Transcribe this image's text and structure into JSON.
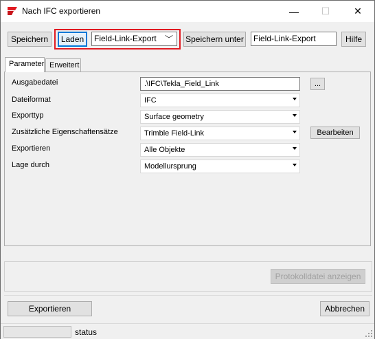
{
  "window": {
    "title": "Nach IFC exportieren",
    "icon": "tekla-red-icon",
    "controls": {
      "minimize": "—",
      "maximize": "☐",
      "close": "✕"
    }
  },
  "toolbar": {
    "save_label": "Speichern",
    "load_label": "Laden",
    "preset_selected": "Field-Link-Export",
    "save_as_label": "Speichern unter",
    "save_as_name": "Field-Link-Export",
    "help_label": "Hilfe"
  },
  "tabs": [
    {
      "label": "Parameter",
      "active": true
    },
    {
      "label": "Erweitert",
      "active": false
    }
  ],
  "parameters": {
    "output_file": {
      "label": "Ausgabedatei",
      "value": ".\\IFC\\Tekla_Field_Link",
      "browse_label": "..."
    },
    "file_format": {
      "label": "Dateiformat",
      "value": "IFC"
    },
    "export_type": {
      "label": "Exporttyp",
      "value": "Surface geometry"
    },
    "property_sets": {
      "label": "Zusätzliche Eigenschaftensätze",
      "value": "Trimble Field-Link",
      "edit_label": "Bearbeiten"
    },
    "export_scope": {
      "label": "Exportieren",
      "value": "Alle Objekte"
    },
    "location_by": {
      "label": "Lage durch",
      "value": "Modellursprung"
    }
  },
  "log_button_label": "Protokolldatei anzeigen",
  "footer": {
    "export_label": "Exportieren",
    "cancel_label": "Abbrechen"
  },
  "statusbar": {
    "text": "status",
    "progress": 0
  },
  "colors": {
    "highlight": "#e11b22",
    "focus": "#0078d7"
  }
}
